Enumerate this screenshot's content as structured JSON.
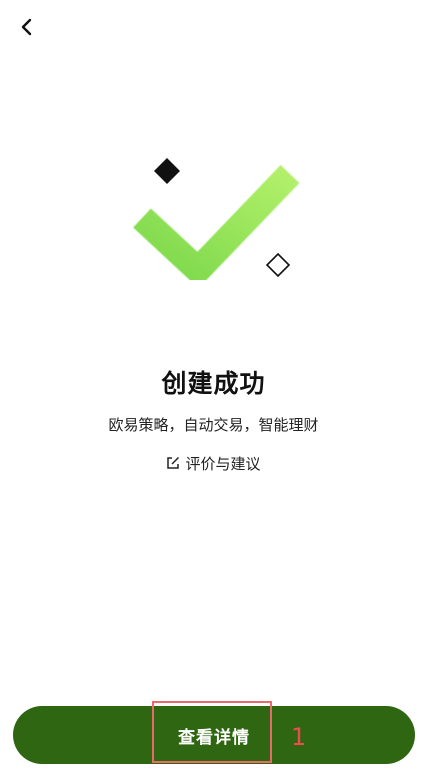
{
  "header": {
    "back_icon": "chevron-left-icon"
  },
  "illustration": {
    "icon": "checkmark-icon",
    "check_color_start": "#7bd84a",
    "check_color_end": "#b2f06a",
    "decorations": [
      "diamond-filled-icon",
      "diamond-outline-icon"
    ]
  },
  "result": {
    "title": "创建成功",
    "subtitle": "欧易策略，自动交易，智能理财",
    "feedback_icon": "edit-icon",
    "feedback_label": "评价与建议"
  },
  "footer": {
    "primary_label": "查看详情",
    "primary_color": "#2f6612"
  },
  "annotation": {
    "label": "1",
    "color": "#ee4d4d"
  }
}
